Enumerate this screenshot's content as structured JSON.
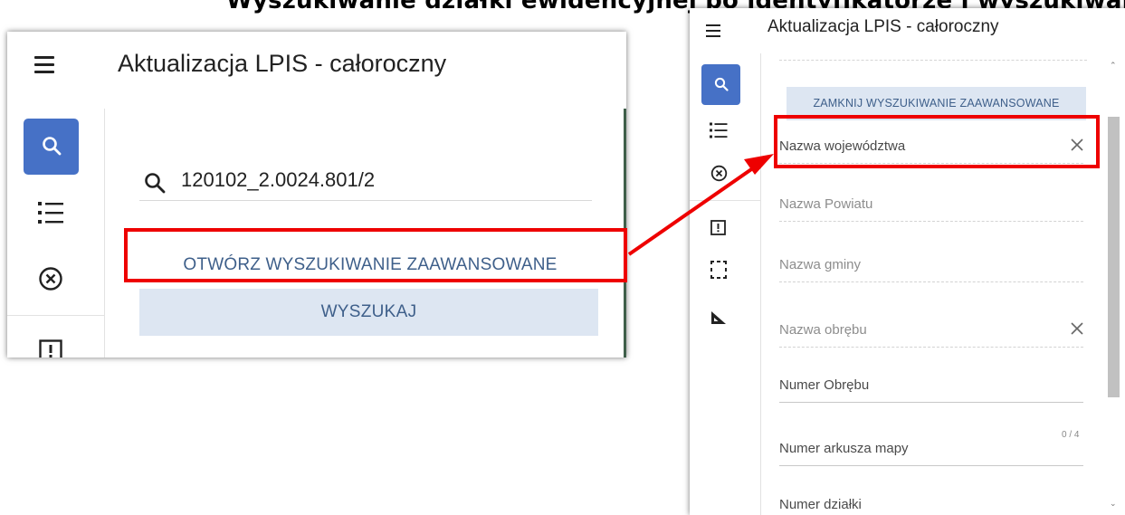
{
  "heading": "Wyszukiwanie działki ewidencyjnej po identyfikatorze i wyszukiwanie zaawansowane",
  "left_panel": {
    "title": "Aktualizacja LPIS - całoroczny",
    "search_value": "120102_2.0024.801/2",
    "advanced_label": "OTWÓRZ WYSZUKIWANIE ZAAWANSOWANE",
    "search_button_label": "WYSZUKAJ"
  },
  "right_panel": {
    "title": "Aktualizacja LPIS - całoroczny",
    "close_advanced_label": "ZAMKNIJ WYSZUKIWANIE ZAAWANSOWANE",
    "fields": [
      {
        "label": "Nazwa województwa",
        "clearable": true
      },
      {
        "label": "Nazwa Powiatu",
        "clearable": false
      },
      {
        "label": "Nazwa gminy",
        "clearable": false
      },
      {
        "label": "Nazwa obrębu",
        "clearable": true
      },
      {
        "label": "Numer Obrębu",
        "clearable": false
      },
      {
        "label": "Numer arkusza mapy",
        "clearable": false
      },
      {
        "label": "Numer działki",
        "clearable": false
      }
    ],
    "counter": "0 / 4"
  },
  "colors": {
    "accent": "#4671c6",
    "button_bg": "#dde6f2",
    "button_text": "#3e5f8a",
    "highlight": "#ee0000"
  }
}
